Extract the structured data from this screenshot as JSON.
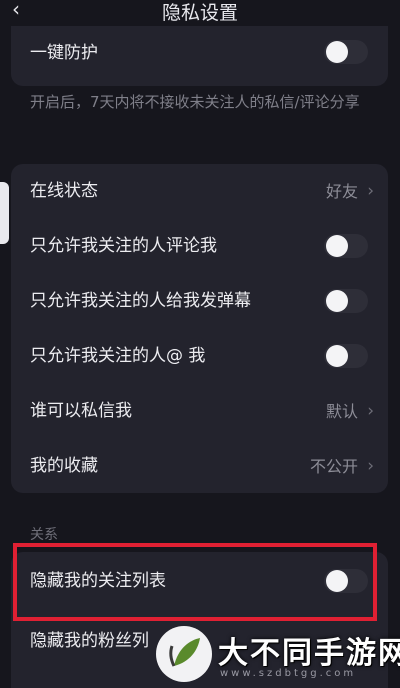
{
  "header": {
    "title": "隐私设置",
    "back_icon": "chevron-left-icon"
  },
  "protection": {
    "label": "一键防护",
    "enabled": false,
    "description": "开启后，7天内将不接收未关注人的私信/评论分享"
  },
  "privacy_items": [
    {
      "label": "在线状态",
      "value": "好友",
      "type": "link"
    },
    {
      "label": "只允许我关注的人评论我",
      "type": "toggle",
      "enabled": false
    },
    {
      "label": "只允许我关注的人给我发弹幕",
      "type": "toggle",
      "enabled": false
    },
    {
      "label": "只允许我关注的人@ 我",
      "type": "toggle",
      "enabled": false
    },
    {
      "label": "谁可以私信我",
      "value": "默认",
      "type": "link"
    },
    {
      "label": "我的收藏",
      "value": "不公开",
      "type": "link"
    }
  ],
  "relations": {
    "section_label": "关系",
    "items": [
      {
        "label": "隐藏我的关注列表",
        "type": "toggle",
        "enabled": false,
        "highlighted": true
      },
      {
        "label": "隐藏我的粉丝列",
        "type": "toggle",
        "enabled": false
      }
    ]
  },
  "watermark": {
    "text": "大不同手游网",
    "url": "www.szdbtgg.com"
  },
  "colors": {
    "background": "#16161d",
    "card": "#23232d",
    "highlight_border": "#e02033"
  }
}
